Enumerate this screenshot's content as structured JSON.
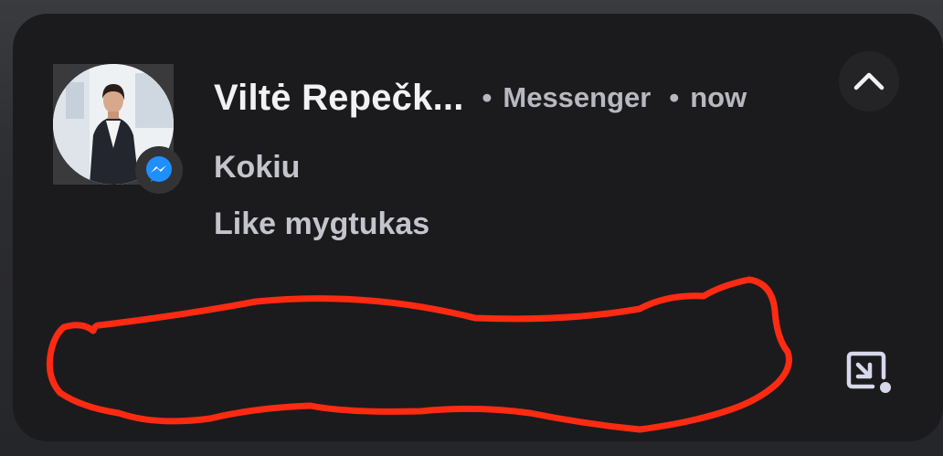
{
  "notification": {
    "sender": "Viltė Repečk...",
    "app": "Messenger",
    "time": "now",
    "separator": "•",
    "messages": [
      "Kokiu",
      "Like mygtukas"
    ]
  },
  "icons": {
    "avatar": "avatar",
    "badge": "messenger-icon",
    "collapse": "chevron-up-icon",
    "popout": "picture-in-picture-icon"
  },
  "colors": {
    "card": "#1b1b1d",
    "messenger_blue": "#1f8fff",
    "annotation_red": "#ff2a12"
  }
}
